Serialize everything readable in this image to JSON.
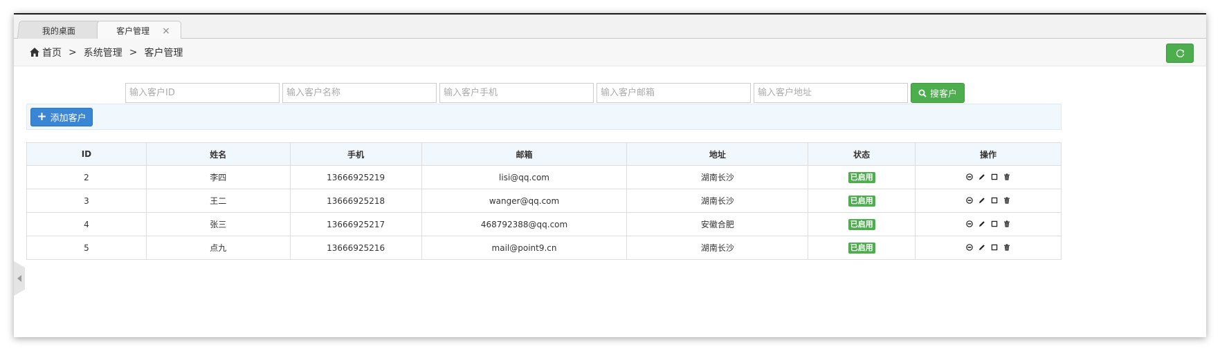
{
  "tabs": [
    {
      "label": "我的桌面"
    },
    {
      "label": "客户管理",
      "close": "×"
    }
  ],
  "breadcrumb": {
    "home": "首页",
    "separator": ">",
    "level1": "系统管理",
    "level2": "客户管理"
  },
  "search": {
    "id_placeholder": "输入客户ID",
    "name_placeholder": "输入客户名称",
    "phone_placeholder": "输入客户手机",
    "email_placeholder": "输入客户邮箱",
    "address_placeholder": "输入客户地址",
    "button_label": "搜客户"
  },
  "toolbar": {
    "add_label": "添加客户"
  },
  "table": {
    "headers": [
      "ID",
      "姓名",
      "手机",
      "邮箱",
      "地址",
      "状态",
      "操作"
    ],
    "rows": [
      {
        "id": "2",
        "name": "李四",
        "phone": "13666925219",
        "email": "lisi@qq.com",
        "address": "湖南长沙",
        "status": "已启用"
      },
      {
        "id": "3",
        "name": "王二",
        "phone": "13666925218",
        "email": "wanger@qq.com",
        "address": "湖南长沙",
        "status": "已启用"
      },
      {
        "id": "4",
        "name": "张三",
        "phone": "13666925217",
        "email": "468792388@qq.com",
        "address": "安徽合肥",
        "status": "已启用"
      },
      {
        "id": "5",
        "name": "点九",
        "phone": "13666925216",
        "email": "mail@point9.cn",
        "address": "湖南长沙",
        "status": "已启用"
      }
    ]
  },
  "colors": {
    "primary": "#3a86d4",
    "success": "#4cae4c",
    "header_bg": "#f0f7fd"
  }
}
